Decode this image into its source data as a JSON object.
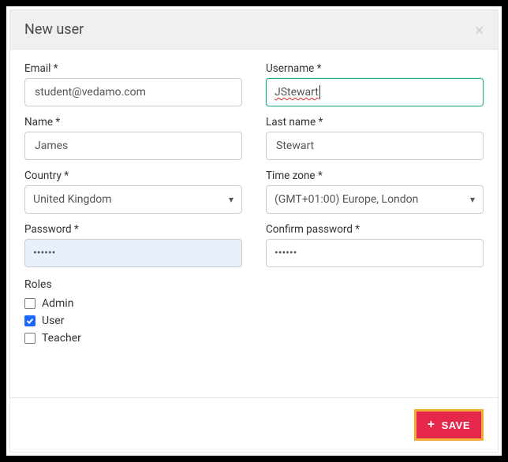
{
  "modal": {
    "title": "New user"
  },
  "fields": {
    "email": {
      "label": "Email *",
      "value": "student@vedamo.com"
    },
    "username": {
      "label": "Username *",
      "value": "JStewart"
    },
    "name": {
      "label": "Name *",
      "value": "James"
    },
    "lastname": {
      "label": "Last name *",
      "value": "Stewart"
    },
    "country": {
      "label": "Country *",
      "value": "United Kingdom"
    },
    "timezone": {
      "label": "Time zone *",
      "value": "(GMT+01:00) Europe, London"
    },
    "password": {
      "label": "Password *",
      "value": "••••••"
    },
    "confirm": {
      "label": "Confirm password *",
      "value": "••••••"
    }
  },
  "roles": {
    "title": "Roles",
    "items": [
      {
        "label": "Admin",
        "checked": false
      },
      {
        "label": "User",
        "checked": true
      },
      {
        "label": "Teacher",
        "checked": false
      }
    ]
  },
  "footer": {
    "save_label": "SAVE"
  }
}
